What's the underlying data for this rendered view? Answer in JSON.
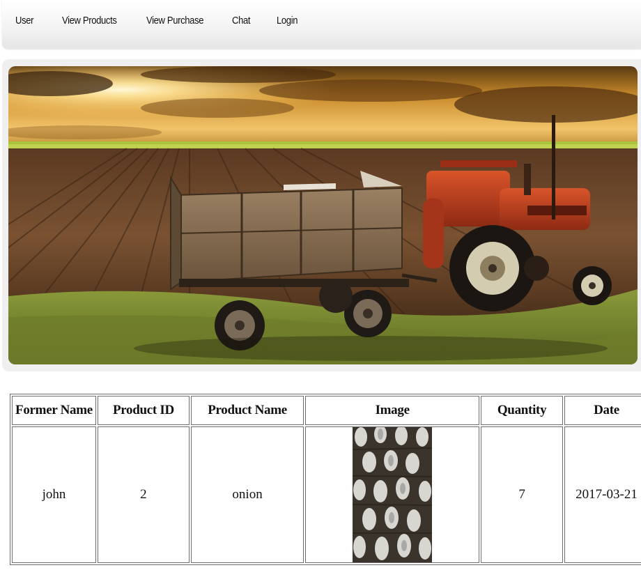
{
  "nav": {
    "items": [
      {
        "label": "User"
      },
      {
        "label": "View Products"
      },
      {
        "label": "View Purchase"
      },
      {
        "label": "Chat"
      },
      {
        "label": "Login"
      }
    ]
  },
  "hero": {
    "image": "farm-tractor-trailer-sunset-banner"
  },
  "table": {
    "headers": [
      "Former Name",
      "Product ID",
      "Product Name",
      "Image",
      "Quantity",
      "Date"
    ],
    "rows": [
      {
        "former_name": "john",
        "product_id": "2",
        "product_name": "onion",
        "image": "onion-product-photo",
        "quantity": "7",
        "date": "2017-03-21"
      }
    ]
  },
  "colors": {
    "nav_text": "#111111",
    "table_border": "#6d6d6d",
    "hero_frame": "#efefef"
  }
}
